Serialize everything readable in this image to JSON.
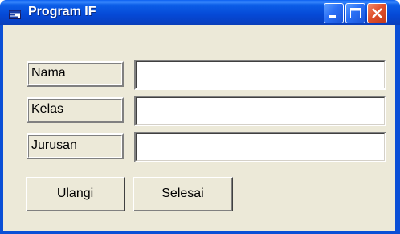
{
  "window": {
    "title": "Program IF",
    "icon": "app-window-icon",
    "controls": [
      "minimize-icon",
      "maximize-icon",
      "close-icon"
    ]
  },
  "form": {
    "fields": [
      {
        "label": "Nama",
        "value": ""
      },
      {
        "label": "Kelas",
        "value": ""
      },
      {
        "label": "Jurusan",
        "value": ""
      }
    ]
  },
  "buttons": {
    "reset_label": "Ulangi",
    "finish_label": "Selesai"
  },
  "colors": {
    "titlebar": "#0549d6",
    "close_button": "#e0502c",
    "face": "#ece9d8"
  }
}
